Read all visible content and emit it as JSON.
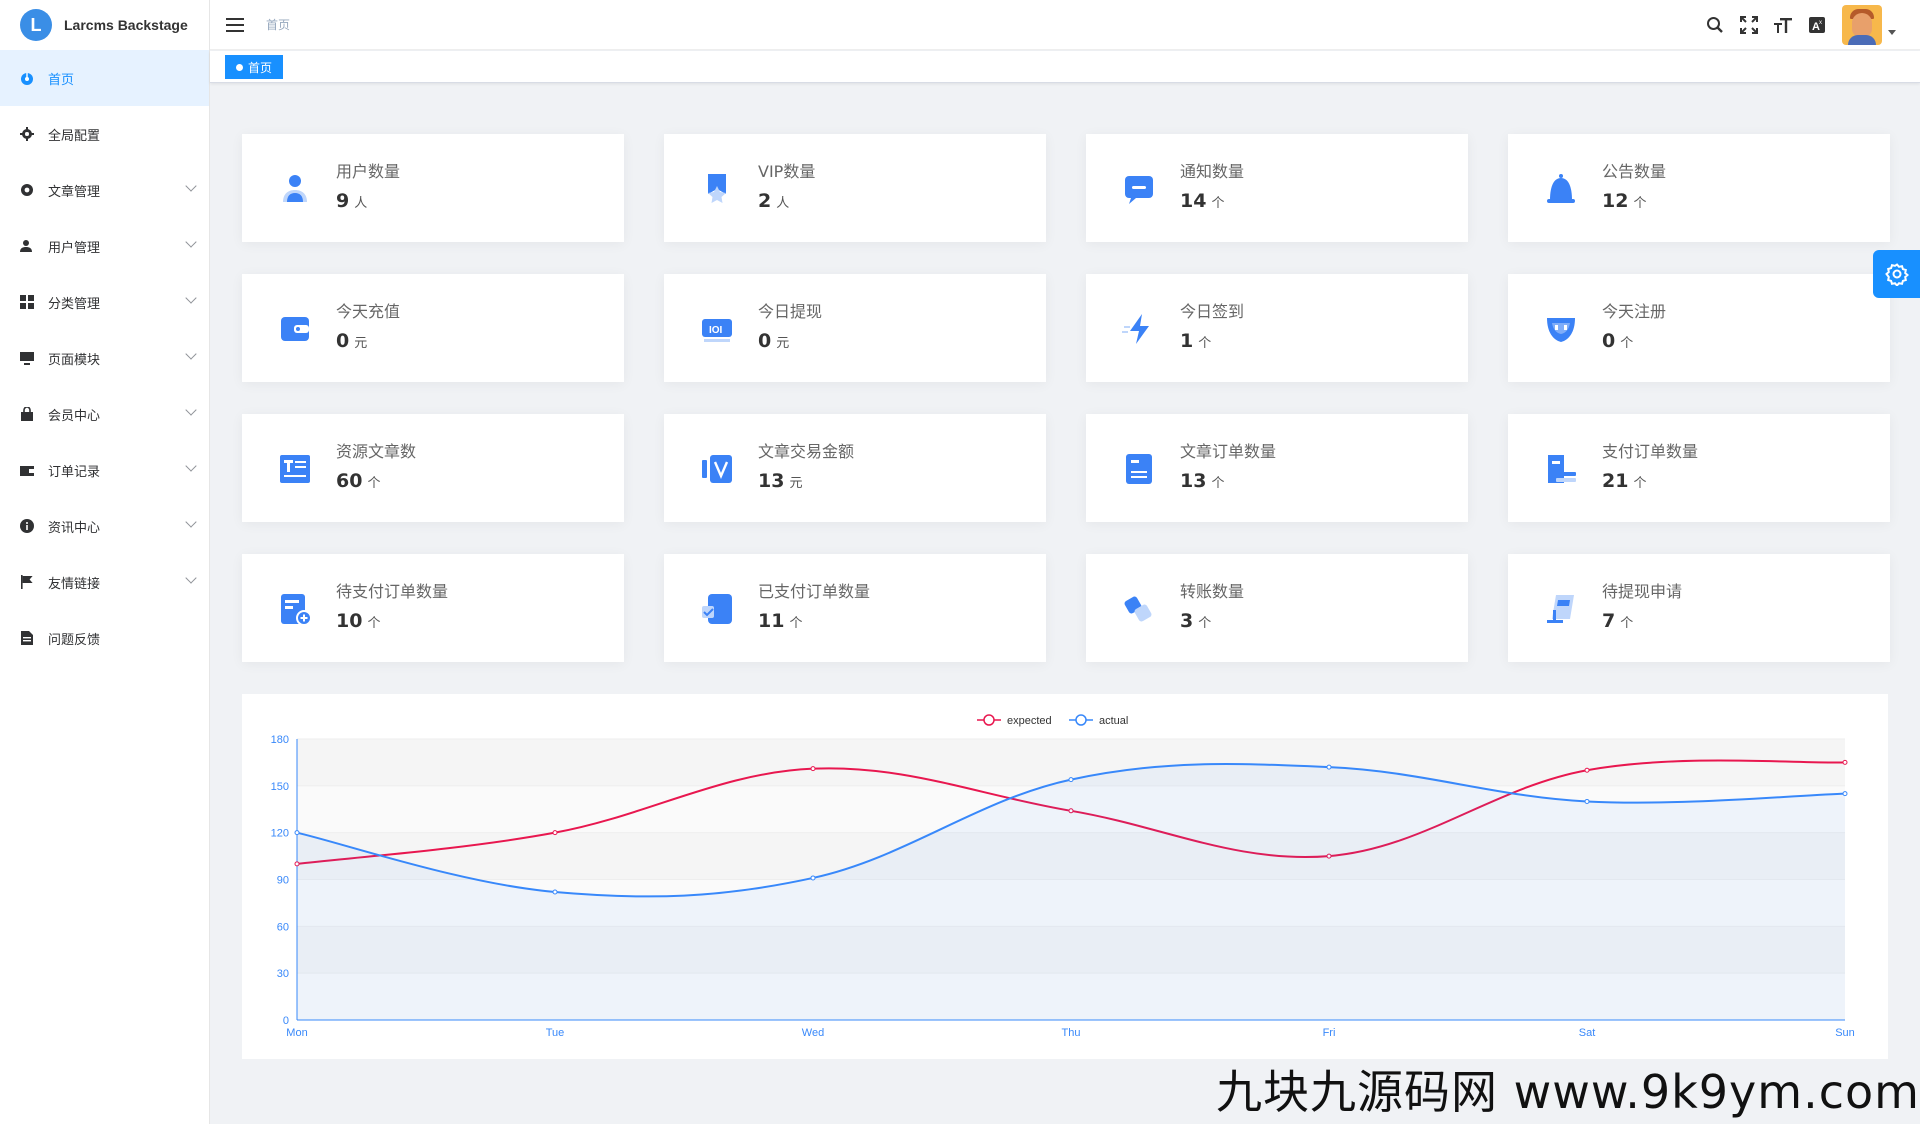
{
  "app": {
    "name": "Larcms Backstage",
    "logo_letter": "L"
  },
  "sidebar": {
    "items": [
      {
        "label": "首页",
        "icon": "dashboard-icon",
        "active": true,
        "expandable": false
      },
      {
        "label": "全局配置",
        "icon": "gear-icon",
        "active": false,
        "expandable": false
      },
      {
        "label": "文章管理",
        "icon": "cog-icon",
        "active": false,
        "expandable": true
      },
      {
        "label": "用户管理",
        "icon": "user-icon",
        "active": false,
        "expandable": true
      },
      {
        "label": "分类管理",
        "icon": "grid-icon",
        "active": false,
        "expandable": true
      },
      {
        "label": "页面模块",
        "icon": "monitor-icon",
        "active": false,
        "expandable": true
      },
      {
        "label": "会员中心",
        "icon": "bag-icon",
        "active": false,
        "expandable": true
      },
      {
        "label": "订单记录",
        "icon": "wallet-icon",
        "active": false,
        "expandable": true
      },
      {
        "label": "资讯中心",
        "icon": "info-icon",
        "active": false,
        "expandable": true
      },
      {
        "label": "友情链接",
        "icon": "flag-icon",
        "active": false,
        "expandable": true
      },
      {
        "label": "问题反馈",
        "icon": "file-icon",
        "active": false,
        "expandable": false
      }
    ]
  },
  "header": {
    "breadcrumb": "首页"
  },
  "tags": {
    "active_tag": "首页"
  },
  "cards": [
    {
      "title": "用户数量",
      "value": "9",
      "unit": "人",
      "icon": "user-group-icon"
    },
    {
      "title": "VIP数量",
      "value": "2",
      "unit": "人",
      "icon": "vip-star-icon"
    },
    {
      "title": "通知数量",
      "value": "14",
      "unit": "个",
      "icon": "message-icon"
    },
    {
      "title": "公告数量",
      "value": "12",
      "unit": "个",
      "icon": "bell-icon"
    },
    {
      "title": "今天充值",
      "value": "0",
      "unit": "元",
      "icon": "wallet-icon"
    },
    {
      "title": "今日提现",
      "value": "0",
      "unit": "元",
      "icon": "cash-icon"
    },
    {
      "title": "今日签到",
      "value": "1",
      "unit": "个",
      "icon": "lightning-icon"
    },
    {
      "title": "今天注册",
      "value": "0",
      "unit": "个",
      "icon": "shield-icon"
    },
    {
      "title": "资源文章数",
      "value": "60",
      "unit": "个",
      "icon": "article-icon"
    },
    {
      "title": "文章交易金额",
      "value": "13",
      "unit": "元",
      "icon": "card-v-icon"
    },
    {
      "title": "文章订单数量",
      "value": "13",
      "unit": "个",
      "icon": "document-icon"
    },
    {
      "title": "支付订单数量",
      "value": "21",
      "unit": "个",
      "icon": "receipt-icon"
    },
    {
      "title": "待支付订单数量",
      "value": "10",
      "unit": "个",
      "icon": "pending-doc-icon"
    },
    {
      "title": "已支付订单数量",
      "value": "11",
      "unit": "个",
      "icon": "check-doc-icon"
    },
    {
      "title": "转账数量",
      "value": "3",
      "unit": "个",
      "icon": "transfer-icon"
    },
    {
      "title": "待提现申请",
      "value": "7",
      "unit": "个",
      "icon": "withdraw-icon"
    }
  ],
  "colors": {
    "primary": "#1890ff",
    "expected": "#e8174f",
    "actual": "#3888fa"
  },
  "watermark": "九块九源码网 www.9k9ym.com",
  "chart_data": {
    "type": "line",
    "categories": [
      "Mon",
      "Tue",
      "Wed",
      "Thu",
      "Fri",
      "Sat",
      "Sun"
    ],
    "series": [
      {
        "name": "expected",
        "values": [
          100,
          120,
          161,
          134,
          105,
          160,
          165
        ]
      },
      {
        "name": "actual",
        "values": [
          120,
          82,
          91,
          154,
          162,
          140,
          145
        ]
      }
    ],
    "y_ticks": [
      0,
      30,
      60,
      90,
      120,
      150,
      180
    ],
    "ylim": [
      0,
      180
    ],
    "legend": "top-center",
    "smooth": true,
    "area_fill": "actual"
  }
}
